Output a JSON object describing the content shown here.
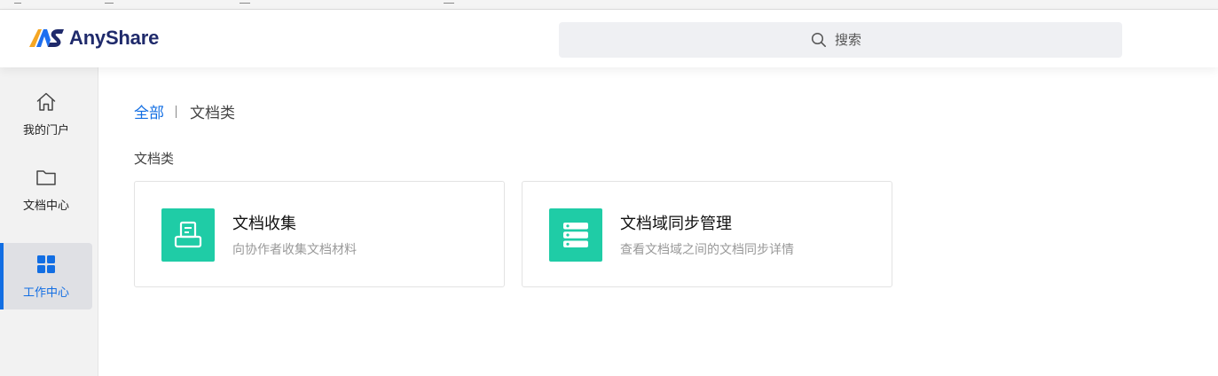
{
  "header": {
    "brand": "AnyShare",
    "search": {
      "placeholder": "搜索"
    }
  },
  "sidebar": {
    "items": [
      {
        "label": "我的门户",
        "icon": "home-icon",
        "active": false
      },
      {
        "label": "文档中心",
        "icon": "folder-icon",
        "active": false
      },
      {
        "label": "工作中心",
        "icon": "grid-apps-icon",
        "active": true
      }
    ]
  },
  "breadcrumb": {
    "root": "全部",
    "current": "文档类"
  },
  "section": {
    "title": "文档类"
  },
  "cards": [
    {
      "title": "文档收集",
      "description": "向协作者收集文档材料",
      "icon": "document-collect-icon"
    },
    {
      "title": "文档域同步管理",
      "description": "查看文档域之间的文档同步详情",
      "icon": "server-sync-icon"
    }
  ],
  "colors": {
    "accent": "#126ee3",
    "card_icon_bg": "#1fcca6",
    "brand_text": "#1f2a6b"
  }
}
